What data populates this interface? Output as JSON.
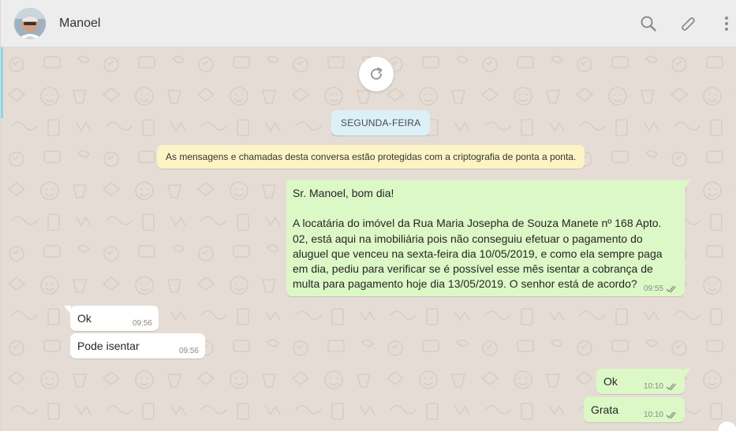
{
  "header": {
    "contact_name": "Manoel",
    "icons": [
      "search-icon",
      "attach-icon",
      "menu-icon"
    ]
  },
  "chat": {
    "day_separator": "SEGUNDA-FEIRA",
    "encryption_notice": "As mensagens e chamadas desta conversa estão protegidas com a criptografia de ponta a ponta.",
    "messages": [
      {
        "direction": "out",
        "text": "Sr. Manoel, bom dia!\n\nA locatária do imóvel da Rua Maria Josepha de Souza Manete nº 168 Apto. 02, está aqui na imobiliária pois não conseguiu efetuar o pagamento do aluguel que venceu na sexta-feira dia 10/05/2019, e como ela sempre paga em dia, pediu para verificar se é possível esse mês isentar a cobrança de multa para pagamento hoje dia 13/05/2019. O senhor está de acordo?",
        "time": "09:55",
        "status": "read"
      },
      {
        "direction": "in",
        "text": "Ok",
        "time": "09:56"
      },
      {
        "direction": "in",
        "text": "Pode isentar",
        "time": "09:56"
      },
      {
        "direction": "out",
        "text": "Ok",
        "time": "10:10",
        "status": "read"
      },
      {
        "direction": "out",
        "text": "Grata",
        "time": "10:10",
        "status": "read"
      }
    ]
  },
  "colors": {
    "chat_bg": "#e5ddd5",
    "outgoing": "#dcf8c6",
    "incoming": "#ffffff",
    "day_pill": "#dcf0f7",
    "encryption_notice_bg": "#fdf4c5",
    "read_ticks": "#8a8a8a"
  }
}
